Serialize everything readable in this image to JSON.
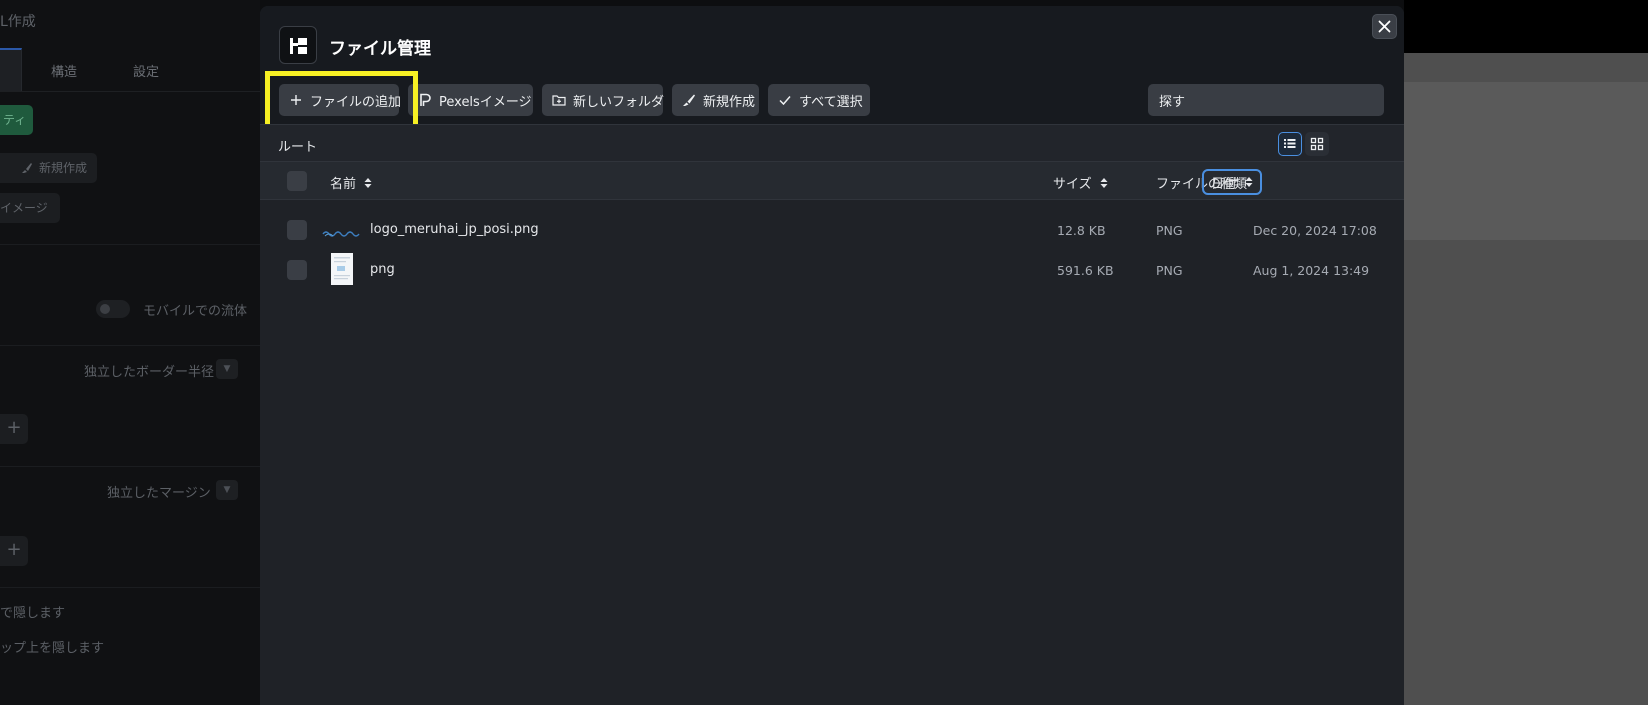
{
  "background": {
    "title": "L作成",
    "tabs": [
      "構造",
      "設定"
    ],
    "green_button": "ティ",
    "new_create_button": "新規作成",
    "image_button": "イメージ",
    "mobile_fluid_label": "モバイルでの流体",
    "border_radius_label": "独立したボーダー半径",
    "margin_label": "独立したマージン",
    "hide_text_1": "で隠します",
    "hide_text_2": "ップ上を隠します"
  },
  "modal": {
    "title": "ファイル管理",
    "toolbar": {
      "add_file": "ファイルの追加",
      "pexels": "Pexelsイメージ",
      "new_folder": "新しいフォルダ",
      "new_create": "新規作成",
      "select_all": "すべて選択"
    },
    "search": {
      "value": "探す"
    },
    "path": "ルート",
    "view_mode": "list",
    "columns": {
      "name": "名前",
      "size": "サイズ",
      "type": "ファイルの種類",
      "date": "日付"
    },
    "files": [
      {
        "name": "logo_meruhai_jp_posi.png",
        "size": "12.8 KB",
        "type": "PNG",
        "date": "Dec 20, 2024 17:08",
        "thumb": "logo"
      },
      {
        "name": "png",
        "size": "591.6 KB",
        "type": "PNG",
        "date": "Aug 1, 2024 13:49",
        "thumb": "document"
      }
    ]
  },
  "colors": {
    "highlight": "#f7f024",
    "accent": "#4a8fe0"
  }
}
